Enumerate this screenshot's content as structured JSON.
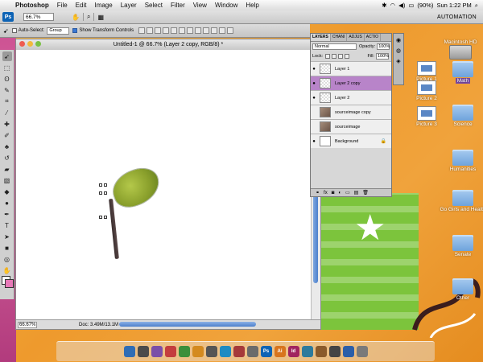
{
  "menubar": {
    "app_name": "Photoshop",
    "items": [
      "File",
      "Edit",
      "Image",
      "Layer",
      "Select",
      "Filter",
      "View",
      "Window",
      "Help"
    ],
    "battery": "(90%)",
    "clock": "Sun 1:22 PM"
  },
  "options": {
    "ps_logo": "Ps",
    "zoom": "66.7%",
    "workspace": "AUTOMATION",
    "auto_select_label": "Auto-Select:",
    "auto_select_value": "Group",
    "show_transform_label": "Show Transform Controls"
  },
  "document": {
    "title": "Untitled-1 @ 66.7% (Layer 2 copy, RGB/8) *",
    "status_zoom": "66.67%",
    "doc_size": "Doc: 3.49M/13.1M"
  },
  "layers_panel": {
    "tabs": [
      "LAYERS",
      "CHANI",
      "ADJUS",
      "ACTIO"
    ],
    "blend_mode": "Normal",
    "opacity_label": "Opacity:",
    "opacity_value": "100%",
    "lock_label": "Lock:",
    "fill_label": "Fill:",
    "fill_value": "100%",
    "layers": [
      {
        "name": "Layer 1",
        "visible": true,
        "selected": false,
        "thumb": "transparent"
      },
      {
        "name": "Layer 2 copy",
        "visible": true,
        "selected": true,
        "thumb": "transparent"
      },
      {
        "name": "Layer 2",
        "visible": true,
        "selected": false,
        "thumb": "transparent"
      },
      {
        "name": "sourceimage copy",
        "visible": false,
        "selected": false,
        "thumb": "photo"
      },
      {
        "name": "sourceimage",
        "visible": false,
        "selected": false,
        "thumb": "photo"
      },
      {
        "name": "Background",
        "visible": true,
        "selected": false,
        "thumb": "white",
        "locked": true
      }
    ]
  },
  "desktop": {
    "items": [
      {
        "label": "Macintosh HD",
        "kind": "hd"
      },
      {
        "label": "Picture 1",
        "kind": "screenshot"
      },
      {
        "label": "Picture 2",
        "kind": "screenshot"
      },
      {
        "label": "Math",
        "kind": "folder"
      },
      {
        "label": "Picture 3",
        "kind": "screenshot"
      },
      {
        "label": "Science",
        "kind": "folder"
      },
      {
        "label": "Humanities",
        "kind": "folder"
      },
      {
        "label": "Go Girls and Health",
        "kind": "folder"
      },
      {
        "label": "Senate",
        "kind": "folder"
      },
      {
        "label": "Other",
        "kind": "folder"
      }
    ]
  },
  "dock": {
    "apps": [
      {
        "label": "Ps",
        "color": "#0d63b5"
      },
      {
        "label": "Ai",
        "color": "#d8741d"
      },
      {
        "label": "Id",
        "color": "#a0245f"
      }
    ]
  },
  "colors": {
    "selected_layer": "#b884c9",
    "foreground_swatch": "#ffffff",
    "background_swatch": "#e879b8"
  }
}
